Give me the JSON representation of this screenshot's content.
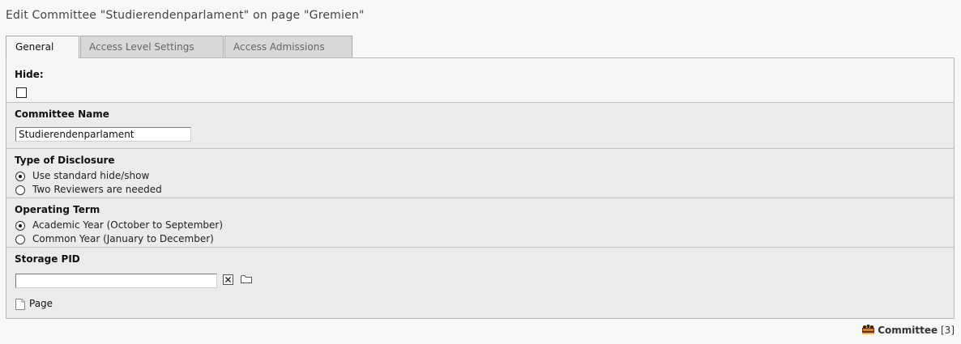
{
  "page": {
    "title": "Edit Committee \"Studierendenparlament\" on page \"Gremien\""
  },
  "tabs": [
    {
      "label": "General",
      "active": true
    },
    {
      "label": "Access Level Settings",
      "active": false
    },
    {
      "label": "Access Admissions",
      "active": false
    }
  ],
  "form": {
    "hide": {
      "label": "Hide:",
      "checked": false
    },
    "committee_name": {
      "label": "Committee Name",
      "value": "Studierendenparlament"
    },
    "disclosure": {
      "label": "Type of Disclosure",
      "options": [
        "Use standard hide/show",
        "Two Reviewers are needed"
      ],
      "selected": 0
    },
    "operating_term": {
      "label": "Operating Term",
      "options": [
        "Academic Year (October to September)",
        "Common Year (January to December)"
      ],
      "selected": 0
    },
    "storage_pid": {
      "label": "Storage PID",
      "value": "",
      "page_link": "Page"
    }
  },
  "footer": {
    "record_type": "Committee",
    "record_id": "[3]"
  },
  "icons": {
    "clear": "clear-x-icon",
    "browse": "folder-icon",
    "page": "page-document-icon",
    "record": "committee-record-icon"
  }
}
